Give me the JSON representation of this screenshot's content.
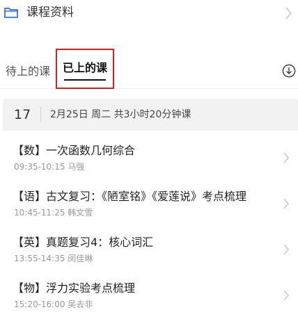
{
  "header": {
    "title": "课程资料",
    "folder_icon": "folder-icon",
    "chevron_icon": "chevron-right-icon"
  },
  "tabs": [
    {
      "label": "待上的课",
      "active": false
    },
    {
      "label": "已上的课",
      "active": true
    }
  ],
  "tabs_action_icon": "download-circle-icon",
  "day": {
    "number": "17",
    "summary": "2月25日 周二 共3小时20分钟课"
  },
  "lessons": [
    {
      "title": "【数】一次函数几何综合",
      "meta": "09:35-10:15 马强"
    },
    {
      "title": "【语】古文复习：《陋室铭》《爱莲说》考点梳理",
      "meta": "10:45-11:25 韩文雪"
    },
    {
      "title": "【英】真题复习4：核心词汇",
      "meta": "13:55-14:35 闵佳琳"
    },
    {
      "title": "【物】浮力实验考点梳理",
      "meta": "15:20-16:00 吴去非"
    }
  ],
  "colors": {
    "highlight_box": "#d42020",
    "folder": "#3b6fd8",
    "day_header_bg": "#f2f2f2"
  }
}
